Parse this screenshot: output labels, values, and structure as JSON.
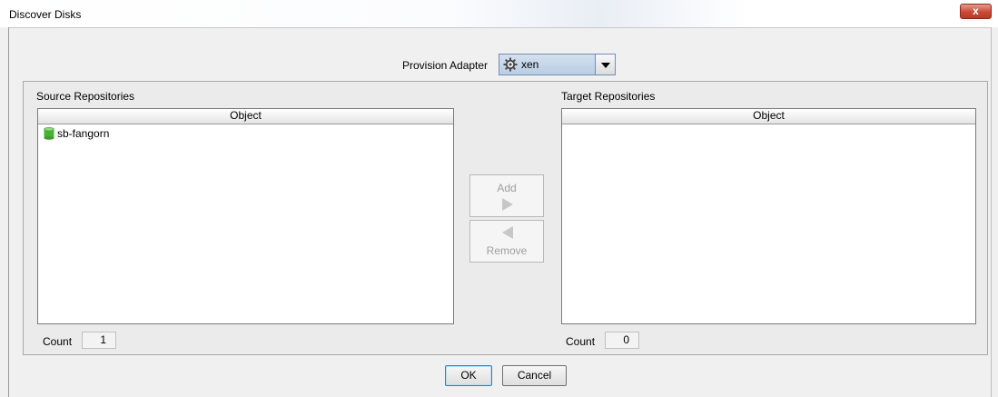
{
  "window": {
    "title": "Discover Disks",
    "close_label": "x"
  },
  "adapter": {
    "label": "Provision Adapter",
    "selected": "xen",
    "icon": "gear-icon"
  },
  "source": {
    "label": "Source Repositories",
    "column_header": "Object",
    "items": [
      {
        "name": "sb-fangorn",
        "icon": "database-cylinder-icon",
        "color": "#4caf3a"
      }
    ],
    "count_label": "Count",
    "count_value": "1"
  },
  "target": {
    "label": "Target Repositories",
    "column_header": "Object",
    "items": [],
    "count_label": "Count",
    "count_value": "0"
  },
  "transfer": {
    "add_label": "Add",
    "remove_label": "Remove"
  },
  "buttons": {
    "ok_label": "OK",
    "cancel_label": "Cancel"
  },
  "colors": {
    "close_button": "#c94a35",
    "select_background": "#c5d6ea",
    "disabled_text": "#9e9e9e"
  }
}
